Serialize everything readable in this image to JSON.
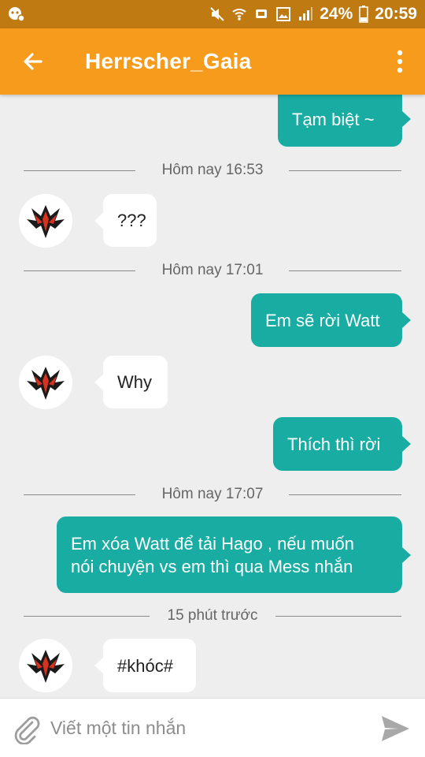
{
  "status_bar": {
    "battery": "24%",
    "time": "20:59"
  },
  "header": {
    "title": "Herrscher_Gaia"
  },
  "messages": [
    {
      "text": "Tạm biệt ~"
    },
    {
      "separator": "Hôm nay 16:53"
    },
    {
      "text": "???"
    },
    {
      "separator": "Hôm nay 17:01"
    },
    {
      "text": "Em sẽ rời Watt"
    },
    {
      "text": "Why"
    },
    {
      "text": "Thích thì rời"
    },
    {
      "separator": "Hôm nay 17:07"
    },
    {
      "text_line1": "Em xóa Watt để tải Hago , nếu muốn",
      "text_line2": "nói chuyện vs em thì qua Mess nhắn"
    },
    {
      "separator": "15 phút trước"
    },
    {
      "text": "#khóc#"
    }
  ],
  "composer": {
    "placeholder": "Viết một tin nhắn"
  },
  "colors": {
    "status_bar": "#c07a12",
    "app_bar": "#f79b1d",
    "outgoing_bubble": "#18aca3",
    "incoming_bubble": "#ffffff",
    "background": "#eeeeee"
  }
}
